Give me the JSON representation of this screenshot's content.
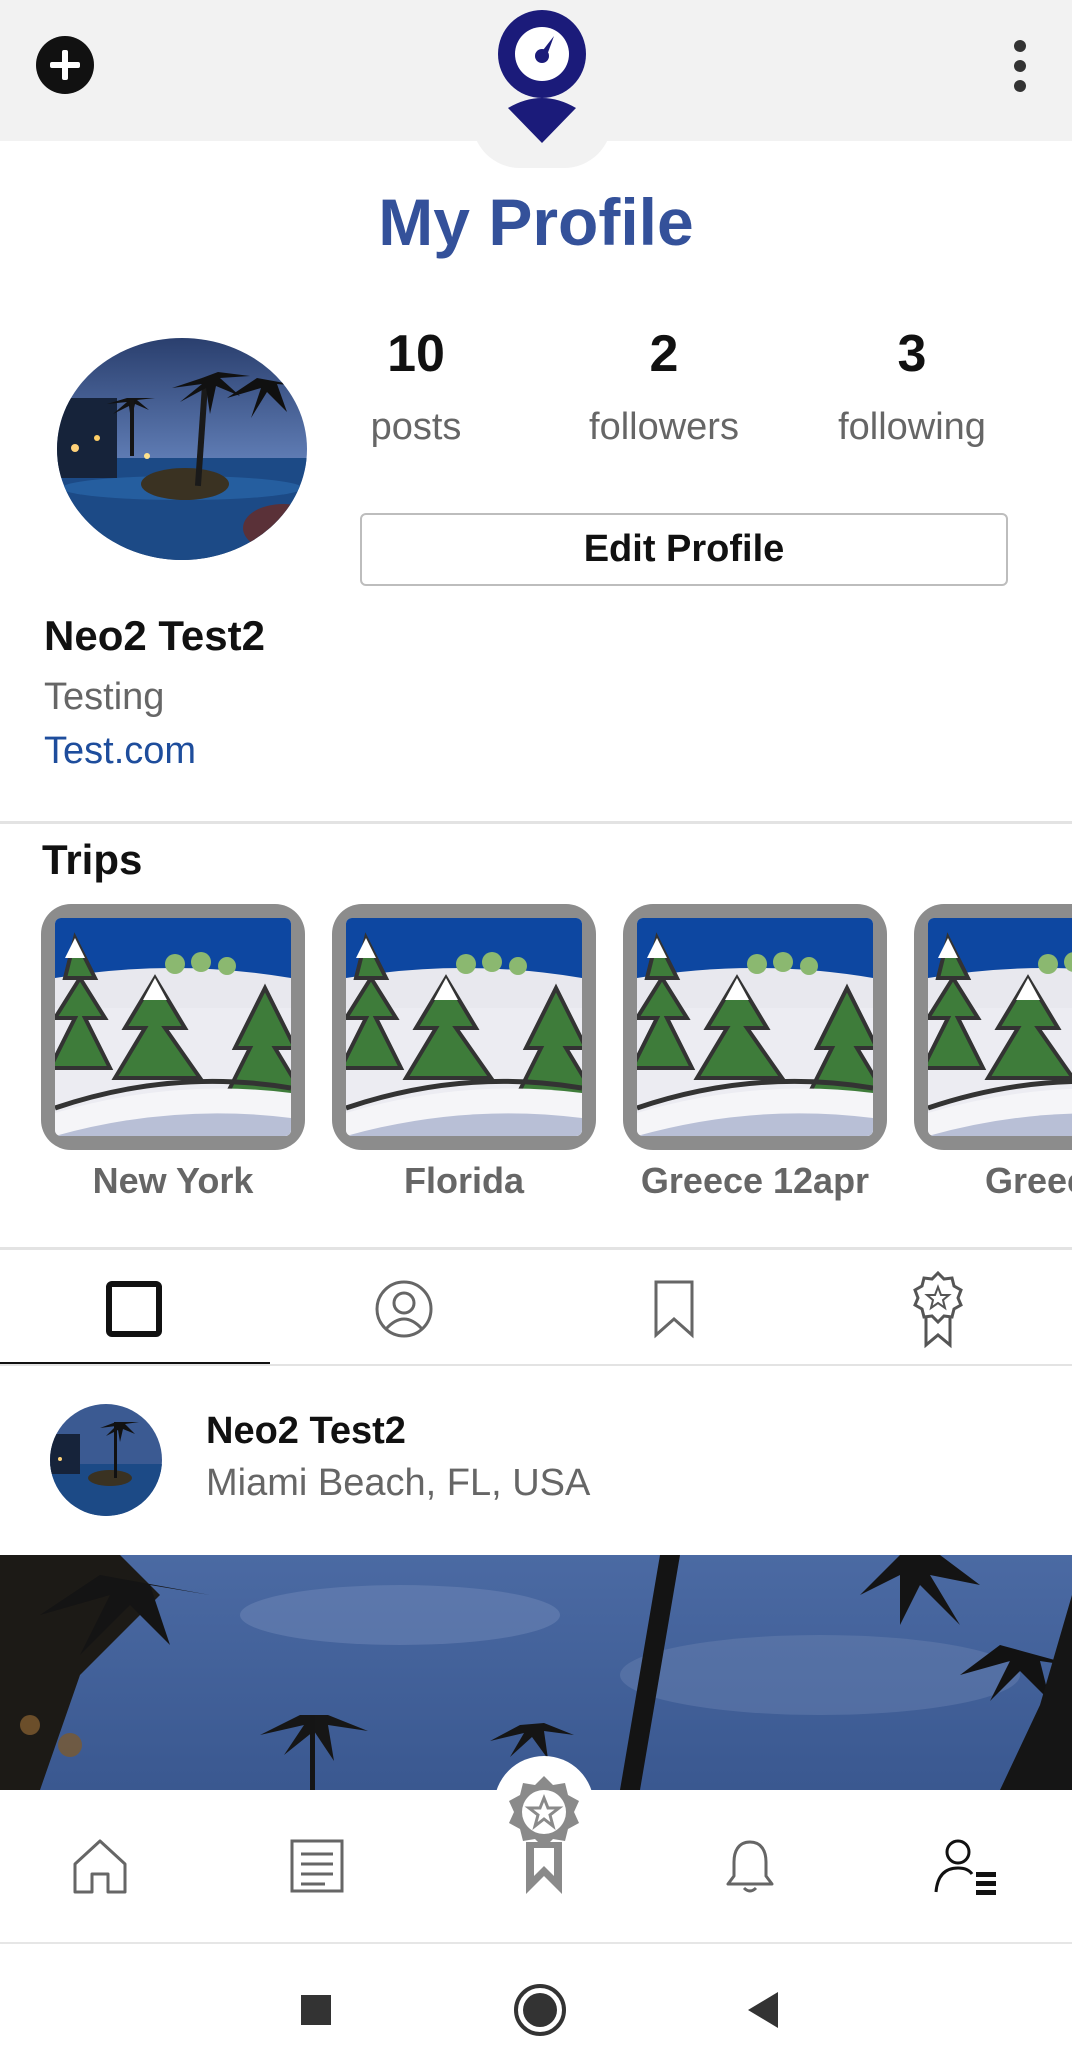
{
  "header": {
    "add_icon": "plus-circle-icon",
    "logo_icon": "compass-pin-logo",
    "menu_icon": "vertical-dots-icon",
    "title": "My Profile"
  },
  "profile": {
    "stats": [
      {
        "value": "10",
        "label": "posts"
      },
      {
        "value": "2",
        "label": "followers"
      },
      {
        "value": "3",
        "label": "following"
      }
    ],
    "edit_label": "Edit Profile",
    "name": "Neo2 Test2",
    "bio": "Testing",
    "website": "Test.com"
  },
  "trips": {
    "title": "Trips",
    "items": [
      {
        "label": "New York"
      },
      {
        "label": "Florida"
      },
      {
        "label": "Greece 12apr"
      },
      {
        "label": "Greece"
      }
    ]
  },
  "tabs": [
    {
      "icon": "grid-square-icon",
      "active": true
    },
    {
      "icon": "user-circle-icon",
      "active": false
    },
    {
      "icon": "bookmark-icon",
      "active": false
    },
    {
      "icon": "award-ribbon-icon",
      "active": false
    }
  ],
  "post": {
    "author": "Neo2 Test2",
    "location": "Miami Beach, FL, USA"
  },
  "bottom_nav": [
    {
      "icon": "home-icon"
    },
    {
      "icon": "feed-list-icon"
    },
    {
      "icon": "award-badge-icon"
    },
    {
      "icon": "bell-icon"
    },
    {
      "icon": "profile-menu-icon",
      "active": true
    }
  ],
  "colors": {
    "brand": "#34519a",
    "logo": "#1b1b7a",
    "link": "#1e4d9c",
    "muted": "#666666"
  }
}
